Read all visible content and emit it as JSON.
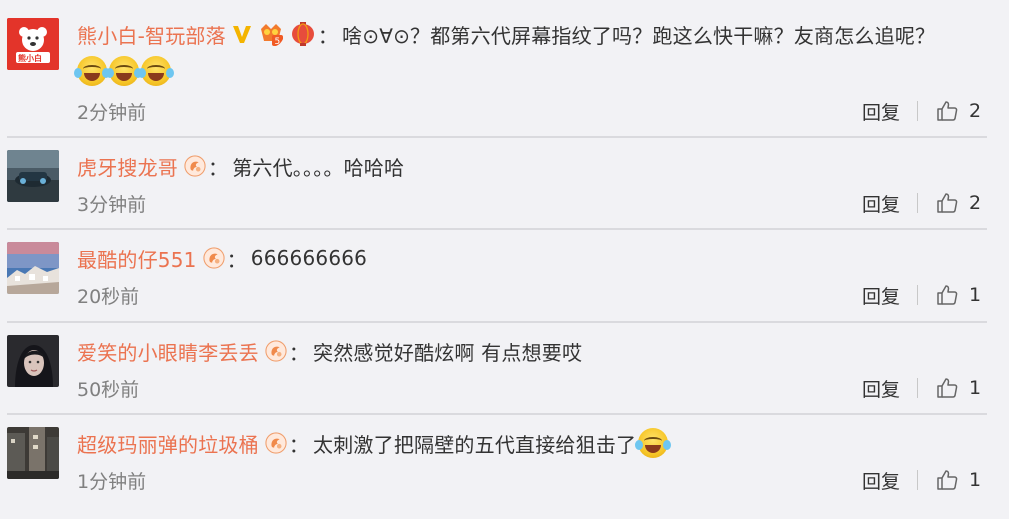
{
  "comments": [
    {
      "username": "熊小白-智玩部落",
      "content": "啥⊙∀⊙？都第六代屏幕指纹了吗？跑这么快干嘛？友商怎么追呢？",
      "emojis": [
        "tears-of-joy-emoji",
        "tears-of-joy-emoji",
        "tears-of-joy-emoji"
      ],
      "avatar_text": "熊小白",
      "time": "2分钟前",
      "reply_label": "回复",
      "likes": "2",
      "badges": [
        "v-verified-icon",
        "level-5-badge-icon",
        "lantern-badge-icon"
      ]
    },
    {
      "username": "虎牙搜龙哥",
      "content": "第六代。。。。哈哈哈",
      "time": "3分钟前",
      "reply_label": "回复",
      "likes": "2",
      "badges": [
        "fan-badge-icon"
      ]
    },
    {
      "username": "最酷的仔551",
      "content": "666666666",
      "time": "20秒前",
      "reply_label": "回复",
      "likes": "1",
      "badges": [
        "fan-badge-icon"
      ]
    },
    {
      "username": "爱笑的小眼睛李丢丢",
      "content": "突然感觉好酷炫啊 有点想要哎",
      "time": "50秒前",
      "reply_label": "回复",
      "likes": "1",
      "badges": [
        "fan-badge-icon"
      ]
    },
    {
      "username": "超级玛丽弹的垃圾桶",
      "content": "太刺激了把隔壁的五代直接给狙击了",
      "time": "1分钟前",
      "reply_label": "回复",
      "likes": "1",
      "badges": [
        "fan-badge-icon"
      ],
      "trailing_emoji": "tears-of-joy-emoji"
    }
  ],
  "colon": "：",
  "colors": {
    "username": "#eb7350",
    "text": "#333333",
    "time": "#808080",
    "background": "#f2f2f5"
  }
}
